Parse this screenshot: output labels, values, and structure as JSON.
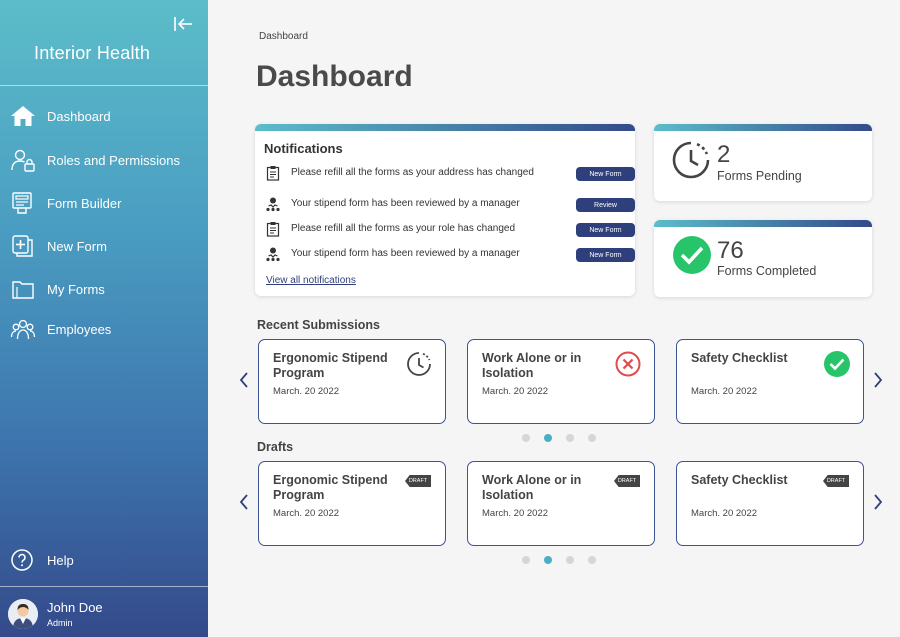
{
  "sidebar": {
    "brand": "Interior Health",
    "items": [
      {
        "label": "Dashboard",
        "icon": "home-icon"
      },
      {
        "label": "Roles and Permissions",
        "icon": "user-lock-icon"
      },
      {
        "label": "Form Builder",
        "icon": "form-builder-icon"
      },
      {
        "label": "New Form",
        "icon": "new-form-icon"
      },
      {
        "label": "My Forms",
        "icon": "folder-icon"
      },
      {
        "label": "Employees",
        "icon": "employees-icon"
      }
    ],
    "help_label": "Help",
    "user": {
      "name": "John Doe",
      "role": "Admin"
    }
  },
  "header": {
    "breadcrumb": "Dashboard",
    "title": "Dashboard"
  },
  "notifications": {
    "title": "Notifications",
    "items": [
      {
        "text": "Please refill all the forms as your address has changed",
        "action": "New Form",
        "icon": "clipboard-icon"
      },
      {
        "text": "Your stipend form has been reviewed by a manager",
        "action": "Review",
        "icon": "manager-icon"
      },
      {
        "text": "Please refill all the forms as your role has changed",
        "action": "New Form",
        "icon": "clipboard-icon"
      },
      {
        "text": "Your stipend form has been reviewed by a manager",
        "action": "New Form",
        "icon": "manager-icon"
      }
    ],
    "view_all": "View all notifications"
  },
  "stats": {
    "pending": {
      "value": "2",
      "label": "Forms Pending"
    },
    "completed": {
      "value": "76",
      "label": "Forms Completed"
    }
  },
  "recent": {
    "title": "Recent Submissions",
    "cards": [
      {
        "title": "Ergonomic Stipend Program",
        "date": "March. 20 2022",
        "status": "pending"
      },
      {
        "title": "Work Alone or in Isolation",
        "date": "March. 20 2022",
        "status": "rejected"
      },
      {
        "title": "Safety Checklist",
        "date": "March. 20 2022",
        "status": "completed"
      }
    ],
    "active_page": 2,
    "pages": 4
  },
  "drafts": {
    "title": "Drafts",
    "tag": "DRAFT",
    "cards": [
      {
        "title": "Ergonomic Stipend Program",
        "date": "March. 20 2022"
      },
      {
        "title": "Work Alone or in Isolation",
        "date": "March. 20 2022"
      },
      {
        "title": "Safety Checklist",
        "date": "March. 20 2022"
      }
    ],
    "active_page": 2,
    "pages": 4
  },
  "colors": {
    "accent_dark": "#2e3f7c",
    "accent_teal": "#4aafc4",
    "success": "#27c46a",
    "danger": "#e24b4b"
  }
}
